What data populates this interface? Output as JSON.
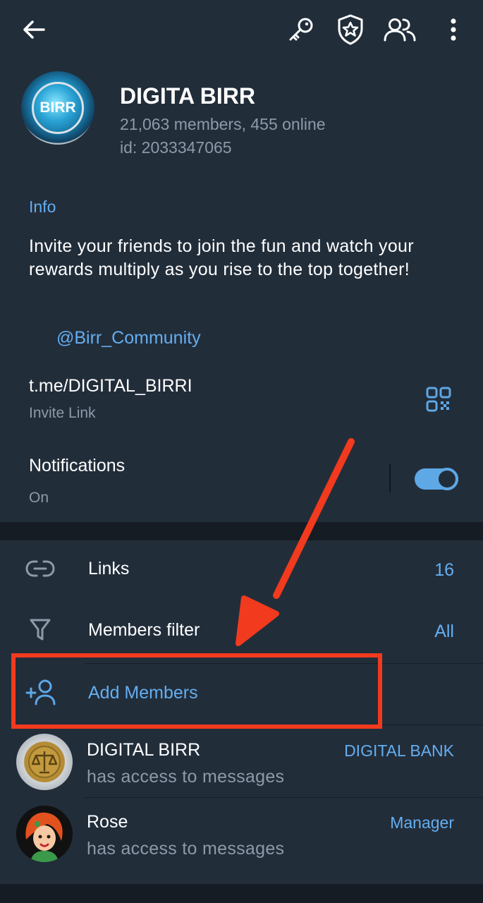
{
  "header": {
    "back_icon": "arrow-left-icon",
    "action_icons": [
      "key-icon",
      "shield-star-icon",
      "members-icon",
      "more-vertical-icon"
    ],
    "avatar_text": "BIRR",
    "title": "DIGITA BIRR",
    "subtitle": "21,063 members, 455 online",
    "id_line": "id: 2033347065"
  },
  "info": {
    "heading": "Info",
    "about": "Invite your friends to join the fun and watch your rewards multiply as you rise to the top together!",
    "mention": "@Birr_Community",
    "invite_link": "t.me/DIGITAL_BIRRI",
    "invite_link_label": "Invite Link",
    "notifications_label": "Notifications",
    "notifications_state": "On",
    "notifications_on": true
  },
  "list": {
    "links_label": "Links",
    "links_count": "16",
    "filter_label": "Members filter",
    "filter_value": "All",
    "add_members_label": "Add Members"
  },
  "members": [
    {
      "name": "DIGITAL BIRR",
      "status": "has access to messages",
      "role": "DIGITAL BANK"
    },
    {
      "name": "Rose",
      "status": "has access to messages",
      "role": "Manager"
    }
  ],
  "colors": {
    "accent": "#64aef0",
    "highlight": "#f23a1e",
    "background": "#222d3a"
  }
}
